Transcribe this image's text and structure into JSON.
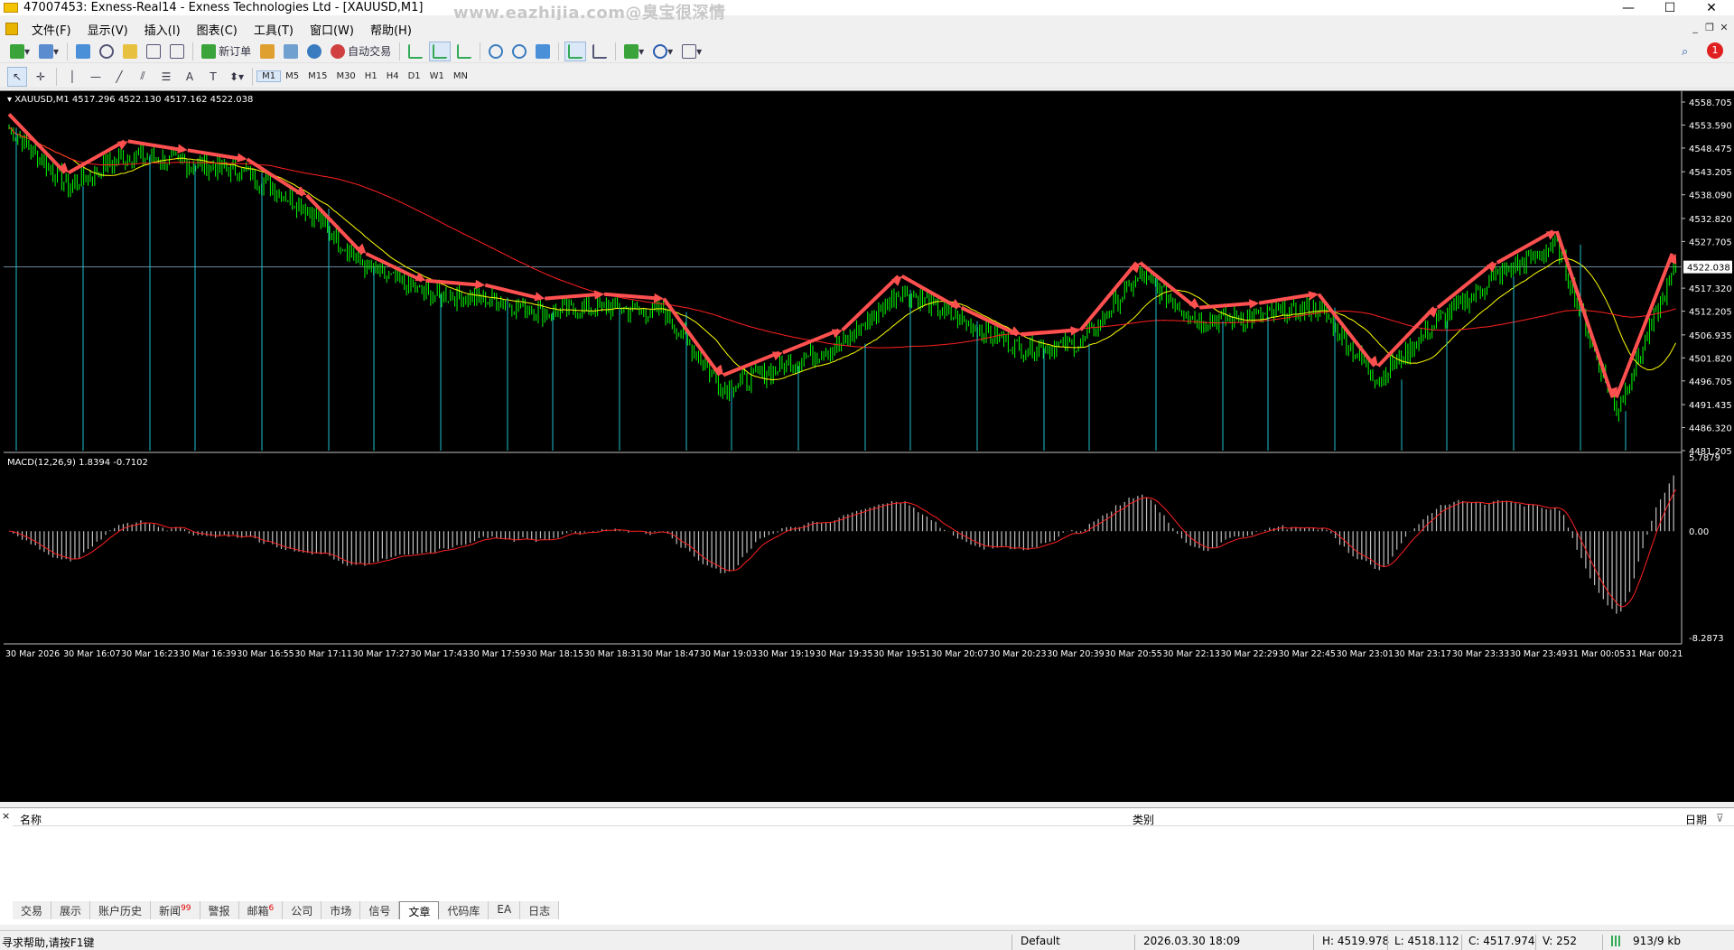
{
  "window": {
    "title": "47007453: Exness-Real14 - Exness Technologies Ltd - [XAUUSD,M1]",
    "watermark": "www.eazhijia.com@臭宝很深情",
    "minimize": "—",
    "maximize": "☐",
    "close": "✕"
  },
  "menu": {
    "items": [
      "文件(F)",
      "显示(V)",
      "插入(I)",
      "图表(C)",
      "工具(T)",
      "窗口(W)",
      "帮助(H)"
    ]
  },
  "toolbar": {
    "new_order": "新订单",
    "auto_trade": "自动交易",
    "notification_count": "1"
  },
  "timeframes": [
    "M1",
    "M5",
    "M15",
    "M30",
    "H1",
    "H4",
    "D1",
    "W1",
    "MN"
  ],
  "chart": {
    "header": "XAUUSD,M1  4517.296 4522.130 4517.162 4522.038",
    "current_price": "4522.038",
    "price_labels": [
      "4558.705",
      "4553.590",
      "4548.475",
      "4543.205",
      "4538.090",
      "4532.820",
      "4527.705",
      "4517.320",
      "4512.205",
      "4506.935",
      "4501.820",
      "4496.705",
      "4491.435",
      "4486.320",
      "4481.205"
    ],
    "macd_header": "MACD(12,26,9) 1.8394 -0.7102",
    "macd_labels": [
      "5.7879",
      "0.00",
      "-8.2873"
    ],
    "time_labels": [
      "30 Mar 2026",
      "30 Mar 16:07",
      "30 Mar 16:23",
      "30 Mar 16:39",
      "30 Mar 16:55",
      "30 Mar 17:11",
      "30 Mar 17:27",
      "30 Mar 17:43",
      "30 Mar 17:59",
      "30 Mar 18:15",
      "30 Mar 18:31",
      "30 Mar 18:47",
      "30 Mar 19:03",
      "30 Mar 19:19",
      "30 Mar 19:35",
      "30 Mar 19:51",
      "30 Mar 20:07",
      "30 Mar 20:23",
      "30 Mar 20:39",
      "30 Mar 20:55",
      "30 Mar 22:13",
      "30 Mar 22:29",
      "30 Mar 22:45",
      "30 Mar 23:01",
      "30 Mar 23:17",
      "30 Mar 23:33",
      "30 Mar 23:49",
      "31 Mar 00:05",
      "31 Mar 00:21"
    ],
    "colors": {
      "background": "#000000",
      "candle": "#00ff00",
      "ma_fast": "#ffff00",
      "ma_slow": "#ff2020",
      "vline": "#20c0d0",
      "arrow": "#ff5050",
      "macd_hist": "#c0c0c0",
      "macd_signal": "#ff2020"
    }
  },
  "chart_data": {
    "type": "line",
    "title": "XAUUSD,M1",
    "xlabel": "",
    "ylabel": "",
    "ylim": [
      4481.205,
      4558.705
    ],
    "x": [
      "30 Mar 2026",
      "30 Mar 16:07",
      "30 Mar 16:23",
      "30 Mar 16:39",
      "30 Mar 16:55",
      "30 Mar 17:11",
      "30 Mar 17:27",
      "30 Mar 17:43",
      "30 Mar 17:59",
      "30 Mar 18:15",
      "30 Mar 18:31",
      "30 Mar 18:47",
      "30 Mar 19:03",
      "30 Mar 19:19",
      "30 Mar 19:35",
      "30 Mar 19:51",
      "30 Mar 20:07",
      "30 Mar 20:23",
      "30 Mar 20:39",
      "30 Mar 20:55",
      "30 Mar 22:13",
      "30 Mar 22:29",
      "30 Mar 22:45",
      "30 Mar 23:01",
      "30 Mar 23:17",
      "30 Mar 23:33",
      "30 Mar 23:49",
      "31 Mar 00:05",
      "31 Mar 00:21"
    ],
    "series": [
      {
        "values": [
          4553,
          4540,
          4547,
          4545,
          4543,
          4535,
          4522,
          4516,
          4515,
          4512,
          4513,
          4512,
          4495,
          4500,
          4505,
          4517,
          4510,
          4504,
          4505,
          4520,
          4510,
          4511,
          4513,
          4497,
          4510,
          4520,
          4527,
          4490,
          4522
        ]
      }
    ],
    "macd": {
      "ylim": [
        -8.2873,
        5.7879
      ],
      "main": 1.8394,
      "signal": -0.7102
    }
  },
  "terminal": {
    "close": "×",
    "columns": [
      "名称",
      "类别",
      "日期"
    ],
    "tabs": [
      {
        "label": "交易",
        "badge": ""
      },
      {
        "label": "展示",
        "badge": ""
      },
      {
        "label": "账户历史",
        "badge": ""
      },
      {
        "label": "新闻",
        "badge": "99"
      },
      {
        "label": "警报",
        "badge": ""
      },
      {
        "label": "邮箱",
        "badge": "6"
      },
      {
        "label": "公司",
        "badge": ""
      },
      {
        "label": "市场",
        "badge": ""
      },
      {
        "label": "信号",
        "badge": ""
      },
      {
        "label": "文章",
        "badge": ""
      },
      {
        "label": "代码库",
        "badge": ""
      },
      {
        "label": "EA",
        "badge": ""
      },
      {
        "label": "日志",
        "badge": ""
      }
    ],
    "active_tab": 9
  },
  "status": {
    "help": "寻求帮助,请按F1键",
    "profile": "Default",
    "datetime": "2026.03.30 18:09",
    "high": "H: 4519.978",
    "low": "L: 4518.112",
    "close": "C: 4517.974",
    "volume": "V: 252",
    "traffic": "913/9 kb"
  }
}
